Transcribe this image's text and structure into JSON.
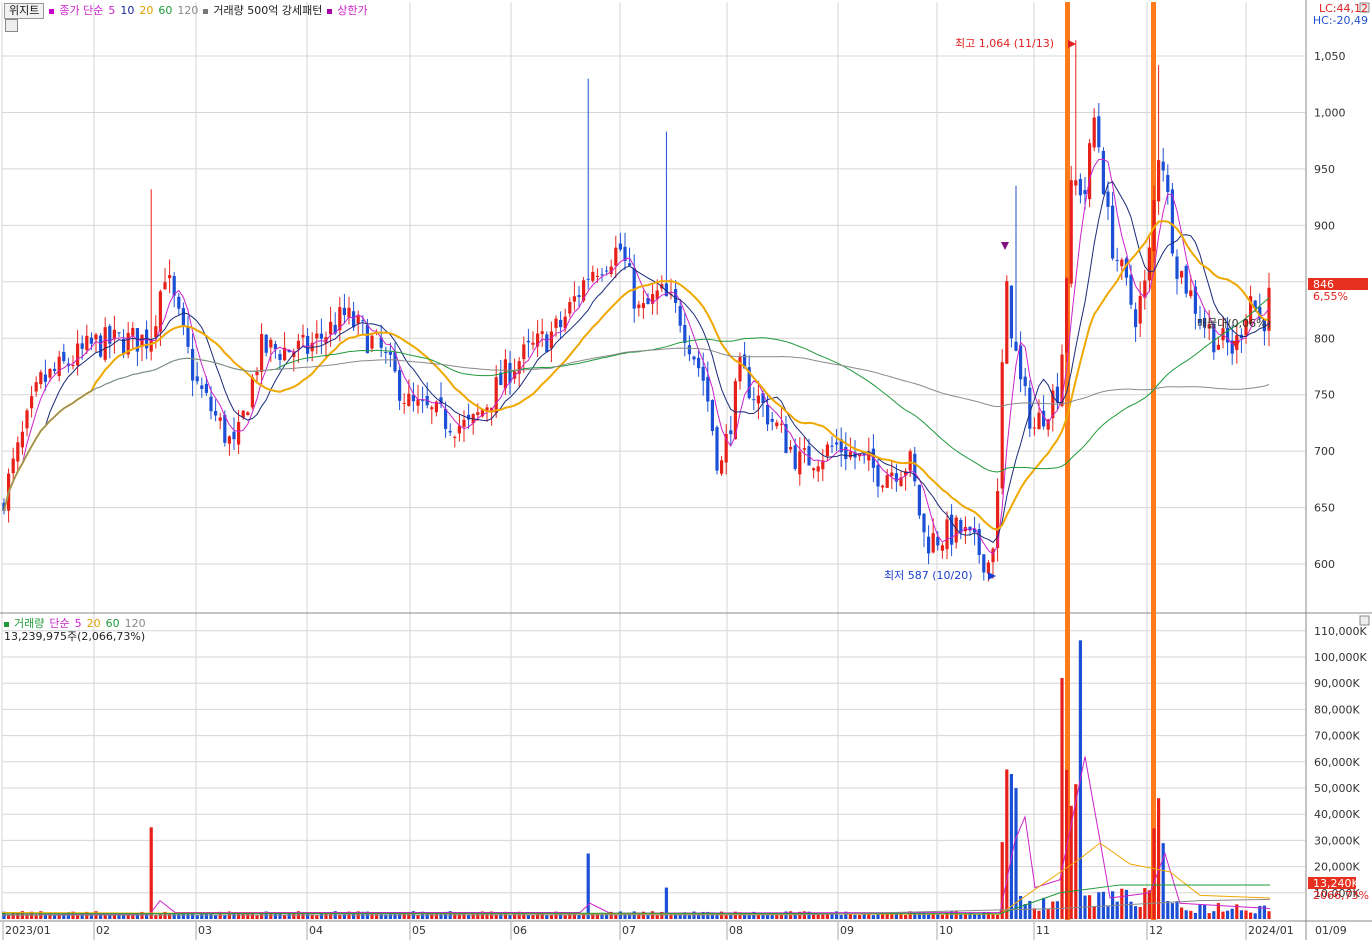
{
  "toolbar": {
    "widget_tab": "위지트",
    "price_ma_label": "종가 단순",
    "ma_periods": [
      "5",
      "10",
      "20",
      "60",
      "120"
    ],
    "volume_filter": "거래량 500억 강세패턴",
    "limit_up": "상한가"
  },
  "top_right": {
    "lc": "LC:44,12",
    "hc": "HC:-20,49"
  },
  "price_axis": {
    "ticks": [
      "1,050",
      "1,000",
      "950",
      "900",
      "850",
      "800",
      "750",
      "700",
      "650",
      "600"
    ],
    "current_value": "846",
    "change": "6,55%"
  },
  "annotations": {
    "high": "최고 1,064 (11/13)",
    "low": "최저 587 (10/20)",
    "balance": "매물대(0,06%)"
  },
  "volume_panel": {
    "label": "거래량",
    "ma_label": "단순",
    "ma_periods": [
      "5",
      "20",
      "60",
      "120"
    ],
    "current_text": "13,239,975주(2,066,73%)",
    "ticks": [
      "110,000K",
      "100,000K",
      "90,000K",
      "80,000K",
      "70,000K",
      "60,000K",
      "50,000K",
      "40,000K",
      "30,000K",
      "20,000K",
      "10,000K"
    ],
    "current_value": "13,240K",
    "current_pct": "2066,73%"
  },
  "date_axis": [
    "2023/01",
    "02",
    "03",
    "04",
    "05",
    "06",
    "07",
    "08",
    "09",
    "10",
    "11",
    "12",
    "2024/01",
    "01/09"
  ],
  "colors": {
    "up": "#e8201a",
    "down": "#1a4fd6",
    "ma5": "#cc22cc",
    "ma10": "#1a2a7a",
    "ma20": "#f0a800",
    "ma60": "#1f9a3a",
    "ma120": "#8a8a8a",
    "highlight": "#ff7a1a",
    "grid": "#d6d6d6"
  },
  "chart_data": {
    "type": "candlestick",
    "price_ylim": [
      565,
      1085
    ],
    "volume_ylim_k": [
      0,
      115000
    ],
    "key_points": [
      {
        "date": "2023/01",
        "close": 650
      },
      {
        "date": "2023/02",
        "close": 795
      },
      {
        "date": "2023/02 spike",
        "high": 932
      },
      {
        "date": "2023/03",
        "close": 700
      },
      {
        "date": "2023/04",
        "close": 810
      },
      {
        "date": "2023/05",
        "close": 735
      },
      {
        "date": "2023/06",
        "close": 790
      },
      {
        "date": "2023/06 high",
        "high": 1030
      },
      {
        "date": "2023/07",
        "close": 810
      },
      {
        "date": "2023/07 high",
        "high": 980
      },
      {
        "date": "2023/08",
        "close": 760
      },
      {
        "date": "2023/09",
        "close": 690
      },
      {
        "date": "2023/10",
        "close": 620
      },
      {
        "date": "10/20",
        "low": 587
      },
      {
        "date": "2023/10 spike",
        "close": 850
      },
      {
        "date": "11/13",
        "high": 1064
      },
      {
        "date": "2023/12",
        "close": 880
      },
      {
        "date": "2024/01",
        "close": 800
      },
      {
        "date": "01/09",
        "close": 846
      }
    ]
  }
}
